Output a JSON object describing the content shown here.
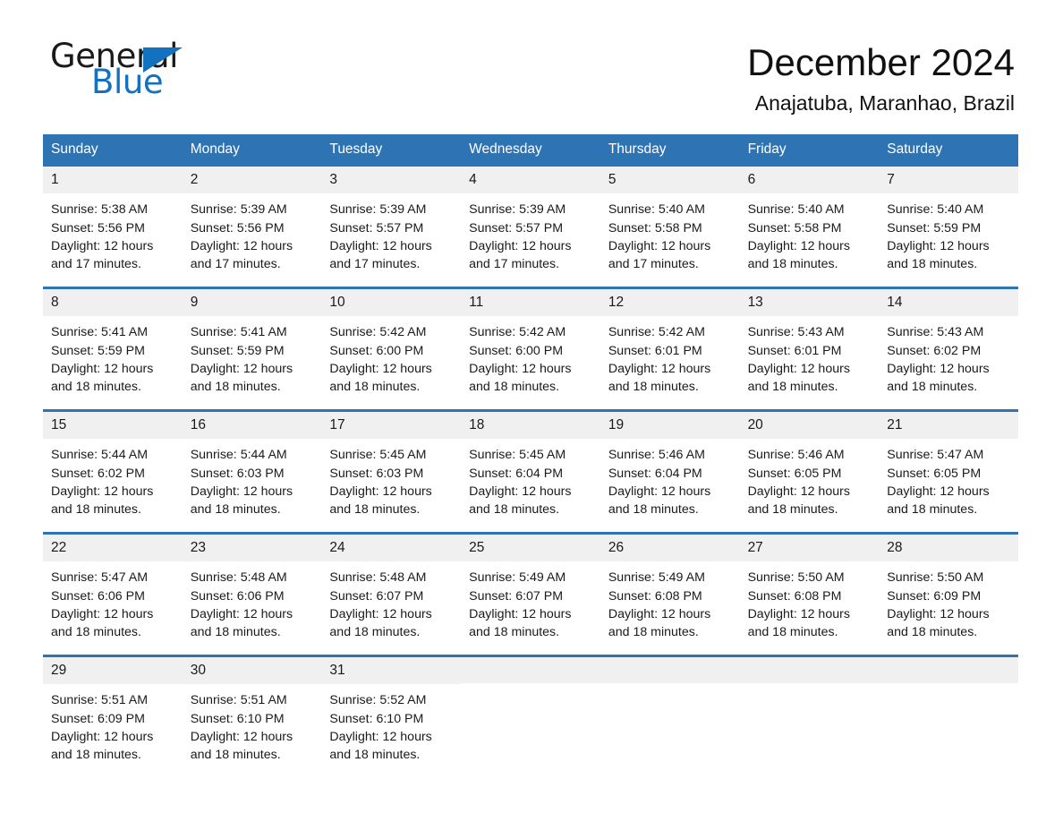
{
  "logo": {
    "word_one": "General",
    "word_two": "Blue",
    "triangle_icon": "triangle-icon",
    "accent_color": "#1272c0"
  },
  "header": {
    "title": "December 2024",
    "subtitle": "Anajatuba, Maranhao, Brazil"
  },
  "theme": {
    "header_blue": "#2e74b5",
    "day_band_gray": "#f0f0f0",
    "text_color": "#1a1a1a"
  },
  "calendar": {
    "weekdays": [
      "Sunday",
      "Monday",
      "Tuesday",
      "Wednesday",
      "Thursday",
      "Friday",
      "Saturday"
    ],
    "weeks": [
      [
        {
          "day": "1",
          "sunrise": "Sunrise: 5:38 AM",
          "sunset": "Sunset: 5:56 PM",
          "daylight": "Daylight: 12 hours and 17 minutes."
        },
        {
          "day": "2",
          "sunrise": "Sunrise: 5:39 AM",
          "sunset": "Sunset: 5:56 PM",
          "daylight": "Daylight: 12 hours and 17 minutes."
        },
        {
          "day": "3",
          "sunrise": "Sunrise: 5:39 AM",
          "sunset": "Sunset: 5:57 PM",
          "daylight": "Daylight: 12 hours and 17 minutes."
        },
        {
          "day": "4",
          "sunrise": "Sunrise: 5:39 AM",
          "sunset": "Sunset: 5:57 PM",
          "daylight": "Daylight: 12 hours and 17 minutes."
        },
        {
          "day": "5",
          "sunrise": "Sunrise: 5:40 AM",
          "sunset": "Sunset: 5:58 PM",
          "daylight": "Daylight: 12 hours and 17 minutes."
        },
        {
          "day": "6",
          "sunrise": "Sunrise: 5:40 AM",
          "sunset": "Sunset: 5:58 PM",
          "daylight": "Daylight: 12 hours and 18 minutes."
        },
        {
          "day": "7",
          "sunrise": "Sunrise: 5:40 AM",
          "sunset": "Sunset: 5:59 PM",
          "daylight": "Daylight: 12 hours and 18 minutes."
        }
      ],
      [
        {
          "day": "8",
          "sunrise": "Sunrise: 5:41 AM",
          "sunset": "Sunset: 5:59 PM",
          "daylight": "Daylight: 12 hours and 18 minutes."
        },
        {
          "day": "9",
          "sunrise": "Sunrise: 5:41 AM",
          "sunset": "Sunset: 5:59 PM",
          "daylight": "Daylight: 12 hours and 18 minutes."
        },
        {
          "day": "10",
          "sunrise": "Sunrise: 5:42 AM",
          "sunset": "Sunset: 6:00 PM",
          "daylight": "Daylight: 12 hours and 18 minutes."
        },
        {
          "day": "11",
          "sunrise": "Sunrise: 5:42 AM",
          "sunset": "Sunset: 6:00 PM",
          "daylight": "Daylight: 12 hours and 18 minutes."
        },
        {
          "day": "12",
          "sunrise": "Sunrise: 5:42 AM",
          "sunset": "Sunset: 6:01 PM",
          "daylight": "Daylight: 12 hours and 18 minutes."
        },
        {
          "day": "13",
          "sunrise": "Sunrise: 5:43 AM",
          "sunset": "Sunset: 6:01 PM",
          "daylight": "Daylight: 12 hours and 18 minutes."
        },
        {
          "day": "14",
          "sunrise": "Sunrise: 5:43 AM",
          "sunset": "Sunset: 6:02 PM",
          "daylight": "Daylight: 12 hours and 18 minutes."
        }
      ],
      [
        {
          "day": "15",
          "sunrise": "Sunrise: 5:44 AM",
          "sunset": "Sunset: 6:02 PM",
          "daylight": "Daylight: 12 hours and 18 minutes."
        },
        {
          "day": "16",
          "sunrise": "Sunrise: 5:44 AM",
          "sunset": "Sunset: 6:03 PM",
          "daylight": "Daylight: 12 hours and 18 minutes."
        },
        {
          "day": "17",
          "sunrise": "Sunrise: 5:45 AM",
          "sunset": "Sunset: 6:03 PM",
          "daylight": "Daylight: 12 hours and 18 minutes."
        },
        {
          "day": "18",
          "sunrise": "Sunrise: 5:45 AM",
          "sunset": "Sunset: 6:04 PM",
          "daylight": "Daylight: 12 hours and 18 minutes."
        },
        {
          "day": "19",
          "sunrise": "Sunrise: 5:46 AM",
          "sunset": "Sunset: 6:04 PM",
          "daylight": "Daylight: 12 hours and 18 minutes."
        },
        {
          "day": "20",
          "sunrise": "Sunrise: 5:46 AM",
          "sunset": "Sunset: 6:05 PM",
          "daylight": "Daylight: 12 hours and 18 minutes."
        },
        {
          "day": "21",
          "sunrise": "Sunrise: 5:47 AM",
          "sunset": "Sunset: 6:05 PM",
          "daylight": "Daylight: 12 hours and 18 minutes."
        }
      ],
      [
        {
          "day": "22",
          "sunrise": "Sunrise: 5:47 AM",
          "sunset": "Sunset: 6:06 PM",
          "daylight": "Daylight: 12 hours and 18 minutes."
        },
        {
          "day": "23",
          "sunrise": "Sunrise: 5:48 AM",
          "sunset": "Sunset: 6:06 PM",
          "daylight": "Daylight: 12 hours and 18 minutes."
        },
        {
          "day": "24",
          "sunrise": "Sunrise: 5:48 AM",
          "sunset": "Sunset: 6:07 PM",
          "daylight": "Daylight: 12 hours and 18 minutes."
        },
        {
          "day": "25",
          "sunrise": "Sunrise: 5:49 AM",
          "sunset": "Sunset: 6:07 PM",
          "daylight": "Daylight: 12 hours and 18 minutes."
        },
        {
          "day": "26",
          "sunrise": "Sunrise: 5:49 AM",
          "sunset": "Sunset: 6:08 PM",
          "daylight": "Daylight: 12 hours and 18 minutes."
        },
        {
          "day": "27",
          "sunrise": "Sunrise: 5:50 AM",
          "sunset": "Sunset: 6:08 PM",
          "daylight": "Daylight: 12 hours and 18 minutes."
        },
        {
          "day": "28",
          "sunrise": "Sunrise: 5:50 AM",
          "sunset": "Sunset: 6:09 PM",
          "daylight": "Daylight: 12 hours and 18 minutes."
        }
      ],
      [
        {
          "day": "29",
          "sunrise": "Sunrise: 5:51 AM",
          "sunset": "Sunset: 6:09 PM",
          "daylight": "Daylight: 12 hours and 18 minutes."
        },
        {
          "day": "30",
          "sunrise": "Sunrise: 5:51 AM",
          "sunset": "Sunset: 6:10 PM",
          "daylight": "Daylight: 12 hours and 18 minutes."
        },
        {
          "day": "31",
          "sunrise": "Sunrise: 5:52 AM",
          "sunset": "Sunset: 6:10 PM",
          "daylight": "Daylight: 12 hours and 18 minutes."
        },
        {
          "day": "",
          "sunrise": "",
          "sunset": "",
          "daylight": ""
        },
        {
          "day": "",
          "sunrise": "",
          "sunset": "",
          "daylight": ""
        },
        {
          "day": "",
          "sunrise": "",
          "sunset": "",
          "daylight": ""
        },
        {
          "day": "",
          "sunrise": "",
          "sunset": "",
          "daylight": ""
        }
      ]
    ]
  }
}
